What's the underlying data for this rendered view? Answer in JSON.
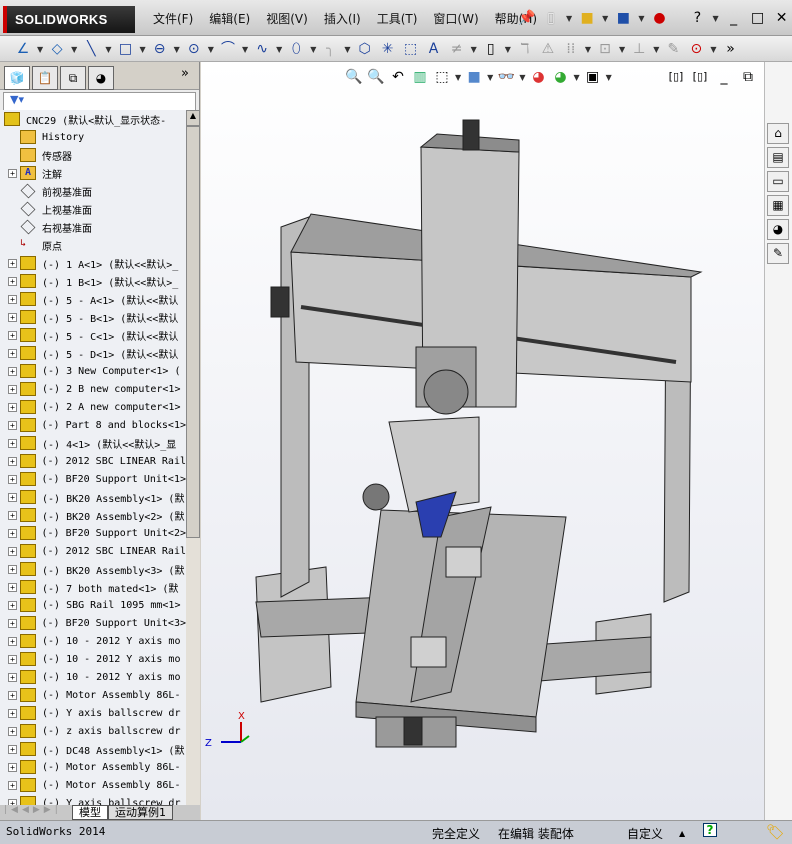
{
  "app": {
    "logo": "SOLIDWORKS",
    "menu": [
      "文件(F)",
      "编辑(E)",
      "视图(V)",
      "插入(I)",
      "工具(T)",
      "窗口(W)",
      "帮助(H)"
    ]
  },
  "panel": {
    "collapse_label": "»",
    "filter_icon": "filter-icon",
    "tree": [
      {
        "label": "CNC29  (默认<默认_显示状态-",
        "type": "assembly-root",
        "expand": false
      },
      {
        "label": "History",
        "type": "history",
        "expand": false
      },
      {
        "label": "传感器",
        "type": "sensor",
        "expand": false
      },
      {
        "label": "注解",
        "type": "annotation",
        "expand": true
      },
      {
        "label": "前视基准面",
        "type": "plane",
        "expand": false
      },
      {
        "label": "上视基准面",
        "type": "plane",
        "expand": false
      },
      {
        "label": "右视基准面",
        "type": "plane",
        "expand": false
      },
      {
        "label": "原点",
        "type": "origin",
        "expand": false
      },
      {
        "label": "(-) 1 A<1> (默认<<默认>_",
        "type": "part",
        "expand": true
      },
      {
        "label": "(-) 1 B<1> (默认<<默认>_",
        "type": "part",
        "expand": true
      },
      {
        "label": "(-) 5 - A<1> (默认<<默认",
        "type": "part",
        "expand": true
      },
      {
        "label": "(-) 5 - B<1> (默认<<默认",
        "type": "part",
        "expand": true
      },
      {
        "label": "(-) 5 - C<1> (默认<<默认",
        "type": "part",
        "expand": true
      },
      {
        "label": "(-) 5 - D<1> (默认<<默认",
        "type": "part",
        "expand": true
      },
      {
        "label": "(-) 3 New Computer<1> (",
        "type": "part",
        "expand": true
      },
      {
        "label": "(-) 2 B new computer<1>",
        "type": "part",
        "expand": true
      },
      {
        "label": "(-) 2 A new computer<1>",
        "type": "part",
        "expand": true
      },
      {
        "label": "(-) Part 8 and blocks<1>",
        "type": "subasm",
        "expand": true
      },
      {
        "label": "(-) 4<1> (默认<<默认>_显",
        "type": "part",
        "expand": true
      },
      {
        "label": "(-) 2012 SBC LINEAR Rail",
        "type": "part",
        "expand": true
      },
      {
        "label": "(-) BF20 Support Unit<1>",
        "type": "part",
        "expand": true
      },
      {
        "label": "(-) BK20 Assembly<1> (默",
        "type": "subasm",
        "expand": true
      },
      {
        "label": "(-) BK20 Assembly<2> (默",
        "type": "subasm",
        "expand": true
      },
      {
        "label": "(-) BF20 Support Unit<2>",
        "type": "part",
        "expand": true
      },
      {
        "label": "(-) 2012 SBC LINEAR Rail",
        "type": "part",
        "expand": true
      },
      {
        "label": "(-) BK20 Assembly<3> (默",
        "type": "subasm",
        "expand": true
      },
      {
        "label": "(-) 7 both mated<1> (默",
        "type": "subasm",
        "expand": true
      },
      {
        "label": "(-) SBG Rail 1095 mm<1>",
        "type": "part",
        "expand": true
      },
      {
        "label": "(-) BF20 Support Unit<3>",
        "type": "part",
        "expand": true
      },
      {
        "label": "(-) 10 - 2012 Y axis mo",
        "type": "part",
        "expand": true
      },
      {
        "label": "(-) 10 - 2012 Y axis mo",
        "type": "part",
        "expand": true
      },
      {
        "label": "(-) 10 - 2012 Y axis mo",
        "type": "part",
        "expand": true
      },
      {
        "label": "(-) Motor Assembly 86L-",
        "type": "subasm",
        "expand": true
      },
      {
        "label": "(-) Y axis ballscrew dr",
        "type": "part",
        "expand": true
      },
      {
        "label": "(-) z axis ballscrew dr",
        "type": "part",
        "expand": true
      },
      {
        "label": "(-) DC48 Assembly<1> (默",
        "type": "subasm",
        "expand": true
      },
      {
        "label": "(-) Motor Assembly 86L-",
        "type": "subasm",
        "expand": true
      },
      {
        "label": "(-) Motor Assembly 86L-",
        "type": "subasm",
        "expand": true
      },
      {
        "label": "(-) Y axis ballscrew dr",
        "type": "part",
        "expand": true
      }
    ],
    "tabs": [
      "模型",
      "运动算例1"
    ]
  },
  "viewport": {
    "triad": {
      "x": "X",
      "y": "Y",
      "z": "Z"
    }
  },
  "status": {
    "app": "SolidWorks 2014",
    "defined": "完全定义",
    "editing": "在编辑 装配体",
    "units": "自定义"
  }
}
